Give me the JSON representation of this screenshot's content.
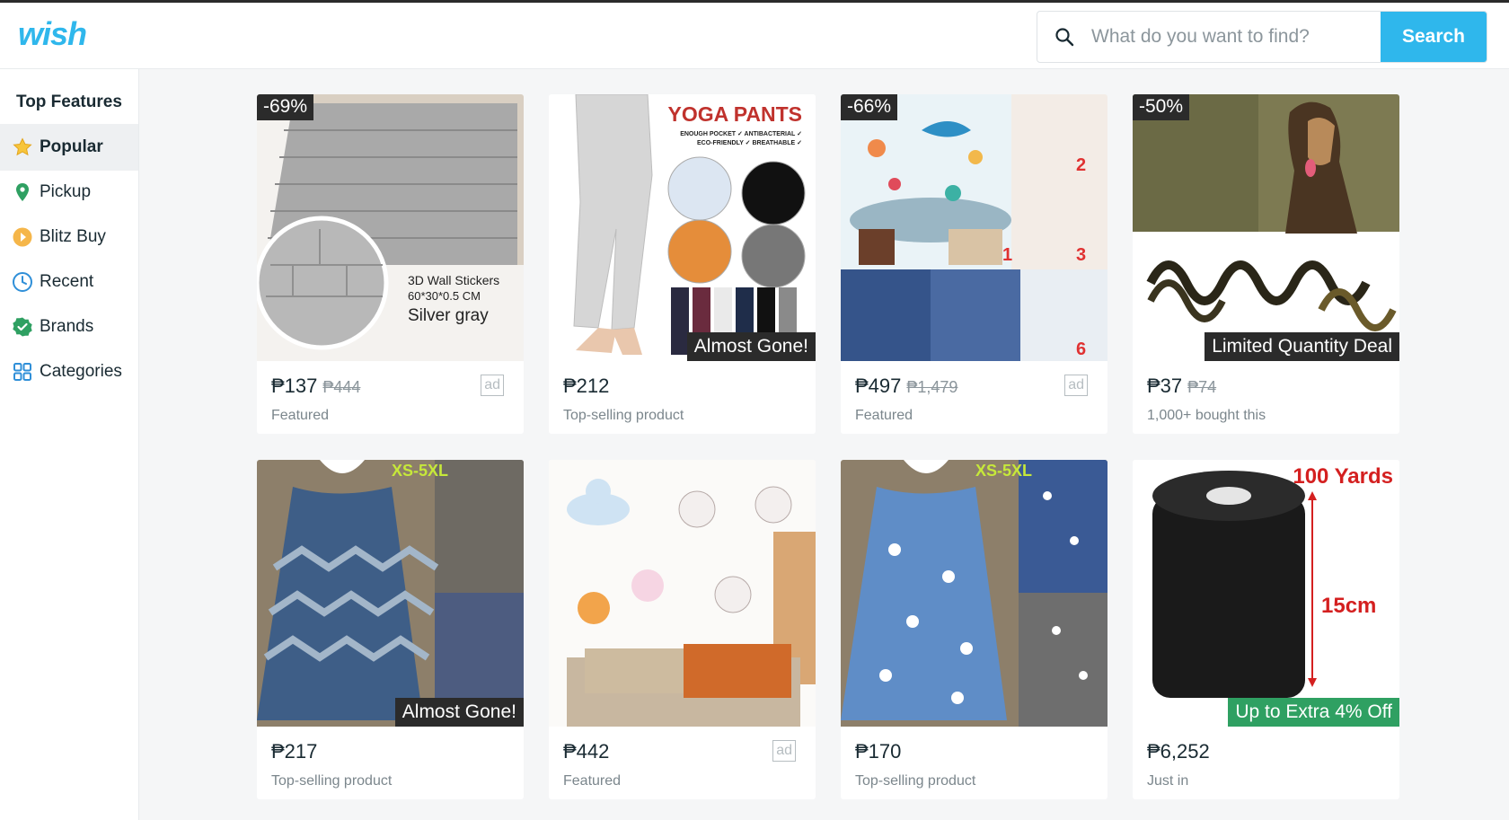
{
  "header": {
    "logo": "wish",
    "search_placeholder": "What do you want to find?",
    "search_button": "Search"
  },
  "sidebar": {
    "title": "Top Features",
    "items": [
      {
        "label": "Popular",
        "icon": "star-icon",
        "active": true
      },
      {
        "label": "Pickup",
        "icon": "location-pin-icon",
        "active": false
      },
      {
        "label": "Blitz Buy",
        "icon": "blitz-icon",
        "active": false
      },
      {
        "label": "Recent",
        "icon": "clock-icon",
        "active": false
      },
      {
        "label": "Brands",
        "icon": "verified-badge-icon",
        "active": false
      },
      {
        "label": "Categories",
        "icon": "grid-icon",
        "active": false
      }
    ]
  },
  "products": [
    {
      "discount": "-69%",
      "price": "₱137",
      "old_price": "₱444",
      "ad": "ad",
      "subtitle": "Featured",
      "banner": "",
      "image": "brick-wall-sticker",
      "image_text": [
        "3D Wall Stickers",
        "60*30*0.5 CM",
        "Silver gray"
      ]
    },
    {
      "discount": "",
      "price": "₱212",
      "old_price": "",
      "ad": "",
      "subtitle": "Top-selling product",
      "banner": "Almost Gone!",
      "image": "yoga-pants",
      "image_text": [
        "YOGA PANTS",
        "ENOUGH POCKET ✓ ANTIBACTERIAL ✓",
        "ECO-FRIENDLY ✓ BREATHABLE ✓"
      ]
    },
    {
      "discount": "-66%",
      "price": "₱497",
      "old_price": "₱1,479",
      "ad": "ad",
      "subtitle": "Featured",
      "banner": "",
      "image": "kids-wall-decals",
      "image_text": [
        "1",
        "2",
        "3",
        "6"
      ]
    },
    {
      "discount": "-50%",
      "price": "₱37",
      "old_price": "₱74",
      "ad": "",
      "subtitle": "1,000+ bought this",
      "banner": "Limited Quantity Deal",
      "image": "dog-leash",
      "image_text": []
    },
    {
      "discount": "",
      "price": "₱217",
      "old_price": "",
      "ad": "",
      "subtitle": "Top-selling product",
      "banner": "Almost Gone!",
      "image": "denim-dress-zigzag",
      "image_text": [
        "XS-5XL"
      ]
    },
    {
      "discount": "",
      "price": "₱442",
      "old_price": "",
      "ad": "ad",
      "subtitle": "Featured",
      "banner": "",
      "image": "animal-wall-stickers",
      "image_text": []
    },
    {
      "discount": "",
      "price": "₱170",
      "old_price": "",
      "ad": "",
      "subtitle": "Top-selling product",
      "banner": "",
      "image": "denim-dress-daisy",
      "image_text": [
        "XS-5XL"
      ]
    },
    {
      "discount": "",
      "price": "₱6,252",
      "old_price": "",
      "ad": "",
      "subtitle": "Just in",
      "banner": "Up to Extra 4% Off",
      "image": "black-fabric-roll",
      "image_text": [
        "100 Yards",
        "15cm"
      ]
    }
  ],
  "colors": {
    "brand": "#2fb7ec",
    "banner_dark": "#2b2b2b",
    "banner_green": "#2fa062"
  }
}
